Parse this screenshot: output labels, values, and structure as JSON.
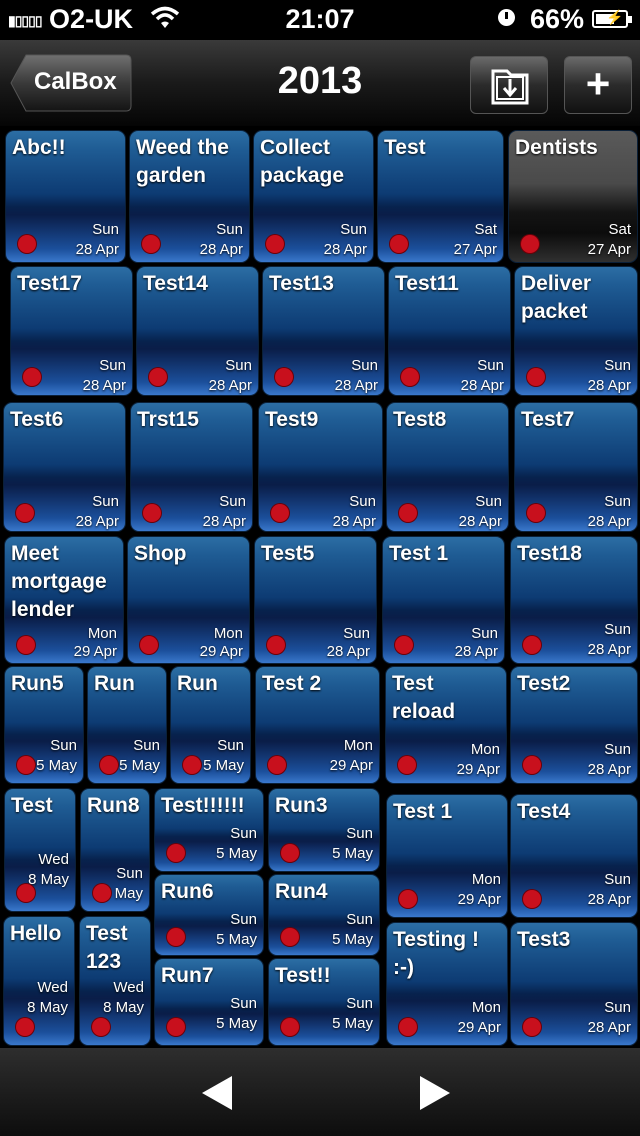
{
  "status_bar": {
    "carrier": "O2-UK",
    "time": "21:07",
    "battery": "66%",
    "battery_level": 0.66
  },
  "nav": {
    "back_label": "CalBox",
    "title": "2013",
    "add_label": "+"
  },
  "tiles": [
    {
      "title": "Abc!!",
      "day": "Sun",
      "date": "28 Apr"
    },
    {
      "title": "Weed the garden",
      "day": "Sun",
      "date": "28 Apr"
    },
    {
      "title": "Collect package",
      "day": "Sun",
      "date": "28 Apr"
    },
    {
      "title": "Test",
      "day": "Sat",
      "date": "27 Apr"
    },
    {
      "title": "Dentists",
      "day": "Sat",
      "date": "27 Apr",
      "style": "grey"
    },
    {
      "title": "Test17",
      "day": "Sun",
      "date": "28 Apr"
    },
    {
      "title": "Test14",
      "day": "Sun",
      "date": "28 Apr"
    },
    {
      "title": "Test13",
      "day": "Sun",
      "date": "28 Apr"
    },
    {
      "title": "Test11",
      "day": "Sun",
      "date": "28 Apr"
    },
    {
      "title": "Deliver packet",
      "day": "Sun",
      "date": "28 Apr"
    },
    {
      "title": "Test6",
      "day": "Sun",
      "date": "28 Apr"
    },
    {
      "title": "Trst15",
      "day": "Sun",
      "date": "28 Apr"
    },
    {
      "title": "Test9",
      "day": "Sun",
      "date": "28 Apr"
    },
    {
      "title": "Test8",
      "day": "Sun",
      "date": "28 Apr"
    },
    {
      "title": "Test7",
      "day": "Sun",
      "date": "28 Apr"
    },
    {
      "title": "Meet mortgage lender",
      "day": "Mon",
      "date": "29 Apr"
    },
    {
      "title": "Shop",
      "day": "Mon",
      "date": "29 Apr"
    },
    {
      "title": "Test5",
      "day": "Sun",
      "date": "28 Apr"
    },
    {
      "title": "Test 1",
      "day": "Sun",
      "date": "28 Apr"
    },
    {
      "title": "Test18",
      "day": "Sun",
      "date": "28 Apr"
    },
    {
      "title": "Run5",
      "day": "Sun",
      "date": "5 May"
    },
    {
      "title": "Run",
      "day": "Sun",
      "date": "5 May"
    },
    {
      "title": "Run",
      "day": "Sun",
      "date": "5 May"
    },
    {
      "title": "Test 2",
      "day": "Mon",
      "date": "29 Apr"
    },
    {
      "title": "Test reload",
      "day": "Mon",
      "date": "29 Apr"
    },
    {
      "title": "Test2",
      "day": "Sun",
      "date": "28 Apr"
    },
    {
      "title": "Test",
      "day": "Wed",
      "date": "8 May"
    },
    {
      "title": "Run8",
      "day": "Sun",
      "date": "5 May"
    },
    {
      "title": "Test!!!!!!",
      "day": "Sun",
      "date": "5 May"
    },
    {
      "title": "Run3",
      "day": "Sun",
      "date": "5 May"
    },
    {
      "title": "Test 1",
      "day": "Mon",
      "date": "29 Apr"
    },
    {
      "title": "Test4",
      "day": "Sun",
      "date": "28 Apr"
    },
    {
      "title": "Run6",
      "day": "Sun",
      "date": "5 May"
    },
    {
      "title": "Run4",
      "day": "Sun",
      "date": "5 May"
    },
    {
      "title": "Hello",
      "day": "Wed",
      "date": "8 May"
    },
    {
      "title": "Test 123",
      "day": "Wed",
      "date": "8 May"
    },
    {
      "title": "Testing ! :-)",
      "day": "Mon",
      "date": "29 Apr"
    },
    {
      "title": "Test3",
      "day": "Sun",
      "date": "28 Apr"
    },
    {
      "title": "Run7",
      "day": "Sun",
      "date": "5 May"
    },
    {
      "title": "Test!!",
      "day": "Sun",
      "date": "5 May"
    }
  ]
}
